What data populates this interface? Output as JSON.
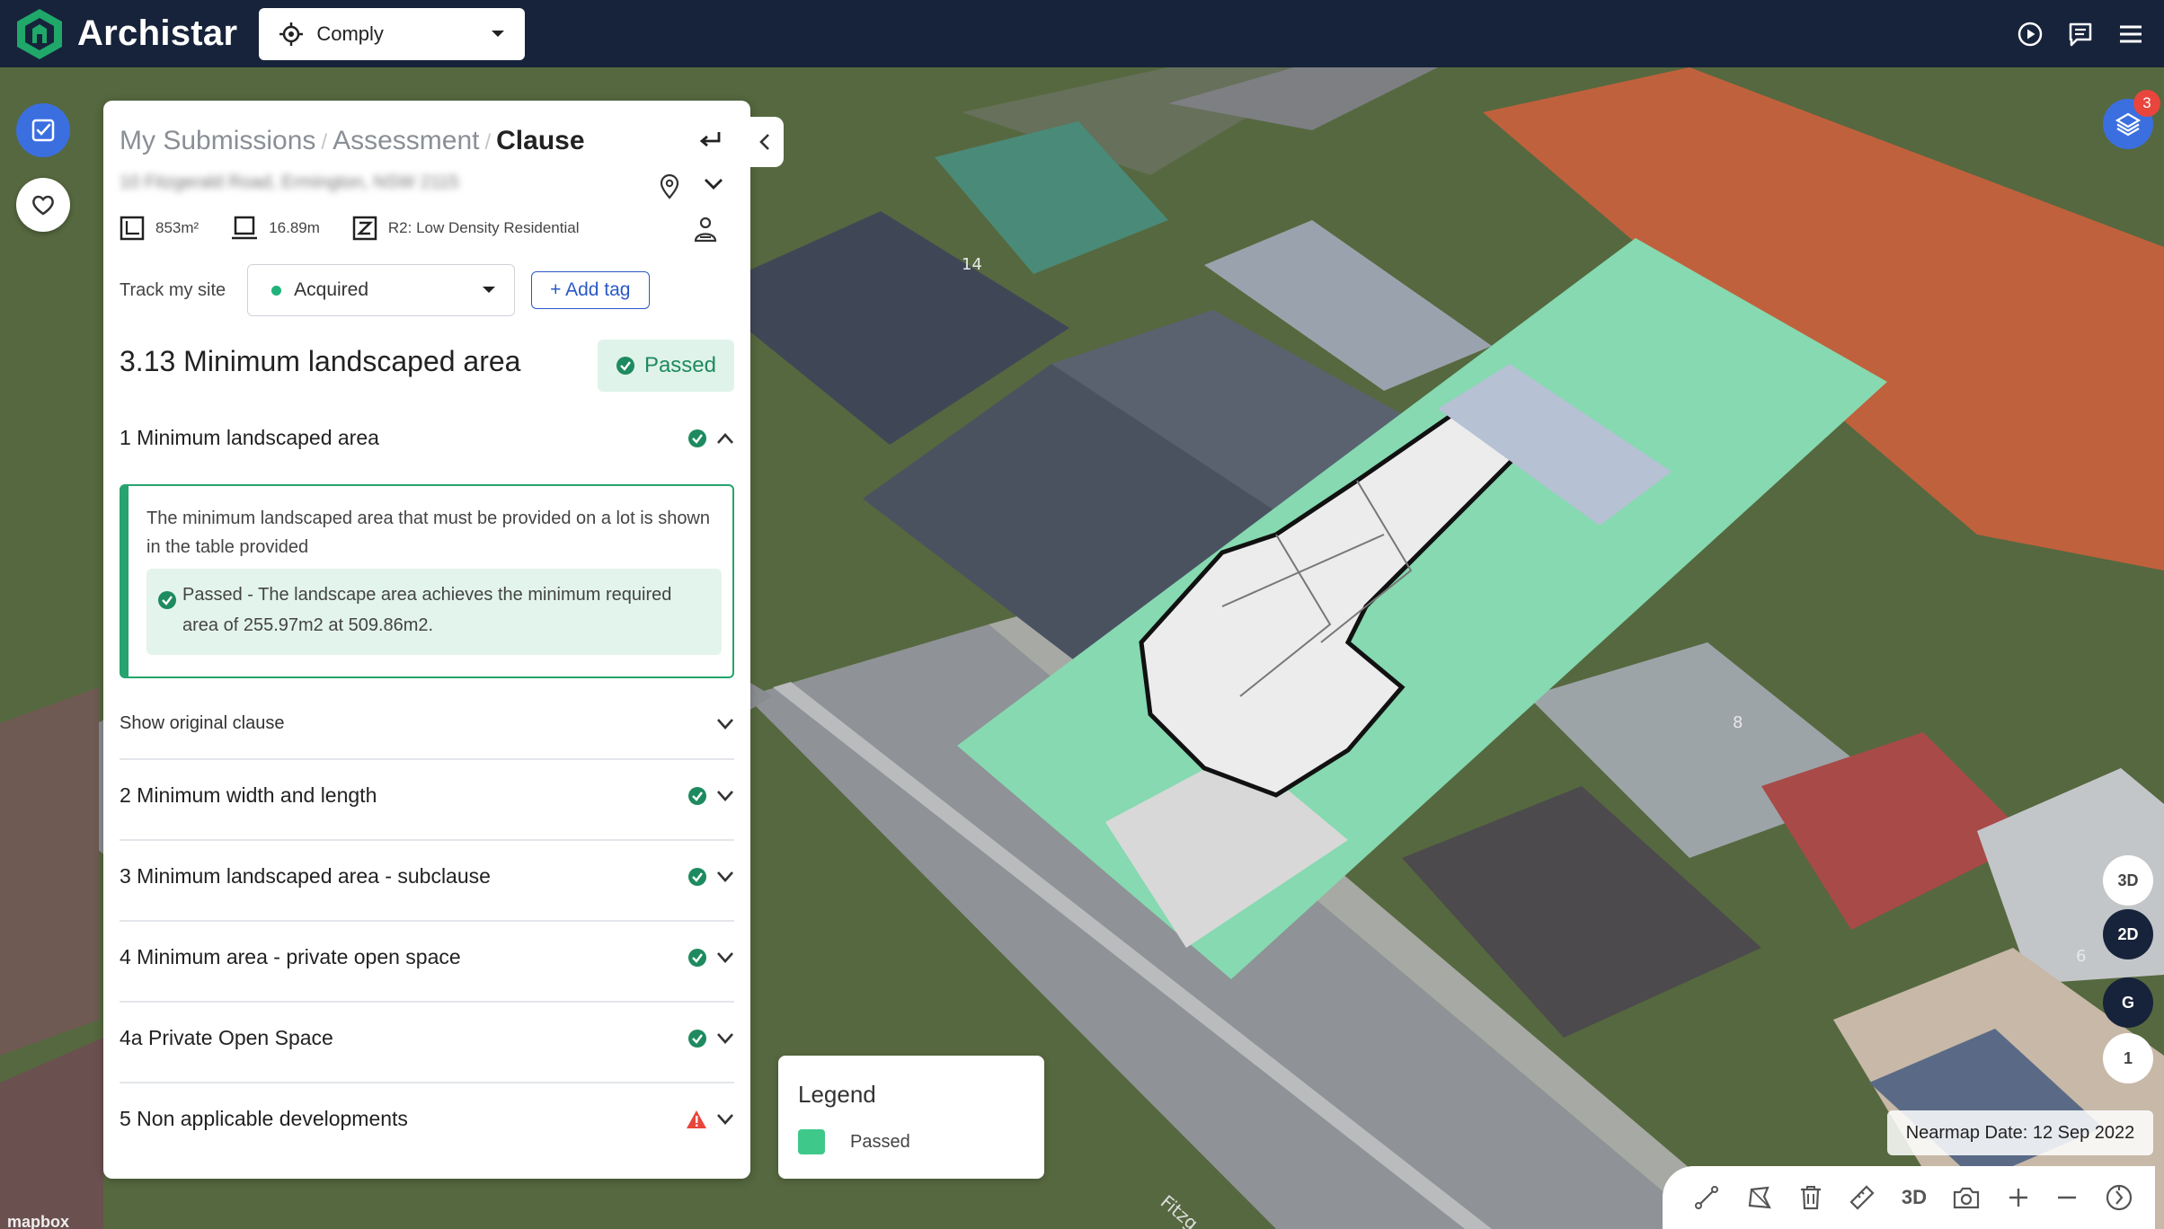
{
  "app": {
    "name": "Archistar",
    "mode": "Comply"
  },
  "breadcrumb": {
    "items": [
      "My Submissions",
      "Assessment"
    ],
    "current": "Clause",
    "separator": "/"
  },
  "site": {
    "address": "10 Fitzgerald Road, Ermington, NSW 2115",
    "area": "853m²",
    "frontage": "16.89m",
    "zone": "R2: Low Density Residential",
    "track_label": "Track my site",
    "track_status": "Acquired",
    "add_tag": "+ Add tag"
  },
  "clause": {
    "title": "3.13 Minimum landscaped area",
    "status": "Passed",
    "expanded": {
      "name": "1 Minimum landscaped area",
      "description": "The minimum landscaped area that must be provided on a lot is shown in the table provided",
      "result": "Passed - The landscape area achieves the minimum required area of 255.97m2 at 509.86m2.",
      "show_original": "Show original clause"
    },
    "subclauses": [
      {
        "name": "2 Minimum width and length",
        "status": "passed"
      },
      {
        "name": "3 Minimum landscaped area - subclause",
        "status": "passed"
      },
      {
        "name": "4 Minimum area - private open space",
        "status": "passed"
      },
      {
        "name": "4a Private Open Space",
        "status": "passed"
      },
      {
        "name": "5 Non applicable developments",
        "status": "warning"
      }
    ]
  },
  "legend": {
    "title": "Legend",
    "items": [
      {
        "label": "Passed",
        "color": "#3ec98a"
      }
    ]
  },
  "map": {
    "layers_badge": "3",
    "view_buttons": [
      "3D",
      "2D",
      "G",
      "1"
    ],
    "nearmap_date": "Nearmap Date: 12 Sep 2022",
    "toolbar_3d": "3D",
    "attribution": "mapbox",
    "street_label": "Fitzg",
    "house_numbers": [
      "14",
      "8",
      "6"
    ]
  },
  "colors": {
    "accent": "#3b6fe0",
    "passed": "#27a36f",
    "topbar": "#17233a",
    "warning": "#e8453c"
  }
}
